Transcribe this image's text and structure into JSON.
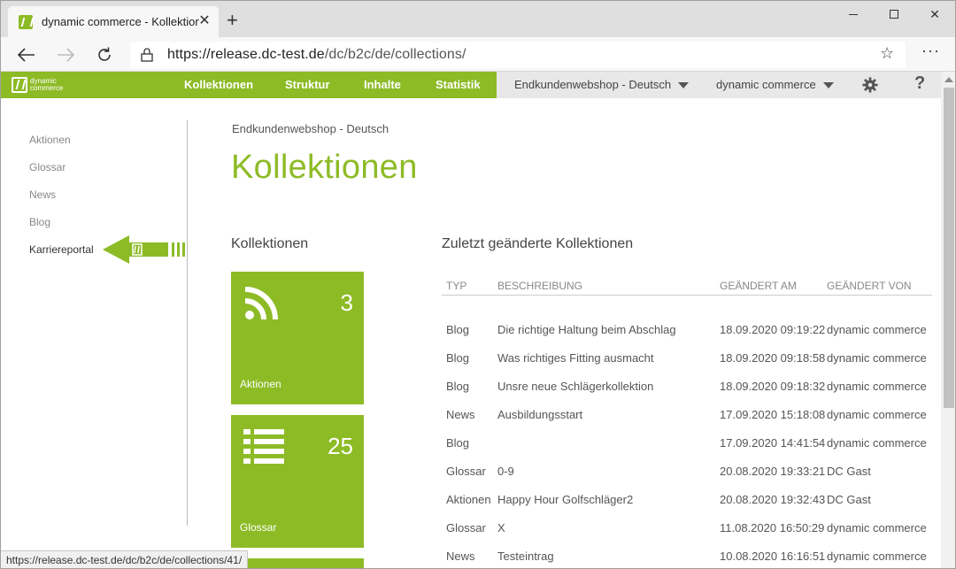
{
  "browser": {
    "tab_title": "dynamic commerce - Kollektione",
    "address_host": "https://release.dc-test.de",
    "address_path": "/dc/b2c/de/collections/",
    "status_url": "https://release.dc-test.de/dc/b2c/de/collections/41/"
  },
  "app": {
    "logo_line1": "dynamic",
    "logo_line2": "commerce",
    "nav": [
      "Kollektionen",
      "Struktur",
      "Inhalte",
      "Statistik"
    ],
    "shop_dropdown": "Endkundenwebshop - Deutsch",
    "user_dropdown": "dynamic commerce",
    "help": "?"
  },
  "sidebar": {
    "items": [
      "Aktionen",
      "Glossar",
      "News",
      "Blog",
      "Karriereportal"
    ]
  },
  "main": {
    "breadcrumb": "Endkundenwebshop - Deutsch",
    "title": "Kollektionen",
    "left_heading": "Kollektionen",
    "right_heading": "Zuletzt geänderte Kollektionen",
    "tiles": [
      {
        "label": "Aktionen",
        "count": "3",
        "icon": "rss-icon"
      },
      {
        "label": "Glossar",
        "count": "25",
        "icon": "list-icon"
      }
    ],
    "table": {
      "headers": [
        "TYP",
        "BESCHREIBUNG",
        "GEÄNDERT AM",
        "GEÄNDERT VON"
      ],
      "rows": [
        [
          "Blog",
          "Die richtige Haltung beim Abschlag",
          "18.09.2020 09:19:22",
          "dynamic commerce"
        ],
        [
          "Blog",
          "Was richtiges Fitting ausmacht",
          "18.09.2020 09:18:58",
          "dynamic commerce"
        ],
        [
          "Blog",
          "Unsre neue Schlägerkollektion",
          "18.09.2020 09:18:32",
          "dynamic commerce"
        ],
        [
          "News",
          "Ausbildungsstart",
          "17.09.2020 15:18:08",
          "dynamic commerce"
        ],
        [
          "Blog",
          "",
          "17.09.2020 14:41:54",
          "dynamic commerce"
        ],
        [
          "Glossar",
          "0-9",
          "20.08.2020 19:33:21",
          "DC Gast"
        ],
        [
          "Aktionen",
          "Happy Hour Golfschläger2",
          "20.08.2020 19:32:43",
          "DC Gast"
        ],
        [
          "Glossar",
          "X",
          "11.08.2020 16:50:29",
          "dynamic commerce"
        ],
        [
          "News",
          "Testeintrag",
          "10.08.2020 16:16:51",
          "dynamic commerce"
        ]
      ]
    }
  },
  "colors": {
    "brand": "#8dbb26"
  }
}
